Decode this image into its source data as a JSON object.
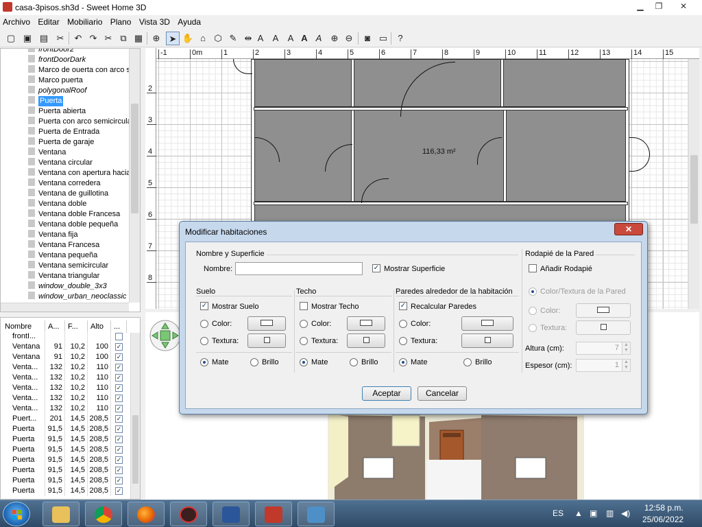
{
  "window": {
    "title": "casa-3pisos.sh3d - Sweet Home 3D"
  },
  "menu": [
    "Archivo",
    "Editar",
    "Mobiliario",
    "Plano",
    "Vista 3D",
    "Ayuda"
  ],
  "catalog": {
    "items": [
      {
        "label": "frontDoor2",
        "italic": true
      },
      {
        "label": "frontDoorDark",
        "italic": true
      },
      {
        "label": "Marco de ouerta con arco s",
        "italic": false
      },
      {
        "label": "Marco puerta",
        "italic": false
      },
      {
        "label": "polygonalRoof",
        "italic": true
      },
      {
        "label": "Puerta",
        "italic": false,
        "selected": true
      },
      {
        "label": "Puerta abierta",
        "italic": false
      },
      {
        "label": "Puerta con arco semicircula",
        "italic": false
      },
      {
        "label": "Puerta de Entrada",
        "italic": false
      },
      {
        "label": "Puerta de garaje",
        "italic": false
      },
      {
        "label": "Ventana",
        "italic": false
      },
      {
        "label": "Ventana circular",
        "italic": false
      },
      {
        "label": "Ventana con apertura hacia",
        "italic": false
      },
      {
        "label": "Ventana corredera",
        "italic": false
      },
      {
        "label": "Ventana de guillotina",
        "italic": false
      },
      {
        "label": "Ventana doble",
        "italic": false
      },
      {
        "label": "Ventana doble Francesa",
        "italic": false
      },
      {
        "label": "Ventana doble pequeña",
        "italic": false
      },
      {
        "label": "Ventana fija",
        "italic": false
      },
      {
        "label": "Ventana Francesa",
        "italic": false
      },
      {
        "label": "Ventana pequeña",
        "italic": false
      },
      {
        "label": "Ventana semicircular",
        "italic": false
      },
      {
        "label": "Ventana triangular",
        "italic": false
      },
      {
        "label": "window_double_3x3",
        "italic": true
      },
      {
        "label": "window_urban_neoclassic",
        "italic": true
      }
    ]
  },
  "furniture": {
    "headers": [
      "Nombre",
      "A...",
      "F...",
      "Alto",
      "..."
    ],
    "rows": [
      [
        "frontI...",
        "",
        "",
        "",
        ""
      ],
      [
        "Ventana",
        "91",
        "10,2",
        "100",
        "✓"
      ],
      [
        "Ventana",
        "91",
        "10,2",
        "100",
        "✓"
      ],
      [
        "Venta...",
        "132",
        "10,2",
        "110",
        "✓"
      ],
      [
        "Venta...",
        "132",
        "10,2",
        "110",
        "✓"
      ],
      [
        "Venta...",
        "132",
        "10,2",
        "110",
        "✓"
      ],
      [
        "Venta...",
        "132",
        "10,2",
        "110",
        "✓"
      ],
      [
        "Venta...",
        "132",
        "10,2",
        "110",
        "✓"
      ],
      [
        "Puert...",
        "201",
        "14,5",
        "208,5",
        "✓"
      ],
      [
        "Puerta",
        "91,5",
        "14,5",
        "208,5",
        "✓"
      ],
      [
        "Puerta",
        "91,5",
        "14,5",
        "208,5",
        "✓"
      ],
      [
        "Puerta",
        "91,5",
        "14,5",
        "208,5",
        "✓"
      ],
      [
        "Puerta",
        "91,5",
        "14,5",
        "208,5",
        "✓"
      ],
      [
        "Puerta",
        "91,5",
        "14,5",
        "208,5",
        "✓"
      ],
      [
        "Puerta",
        "91,5",
        "14,5",
        "208,5",
        "✓"
      ],
      [
        "Puerta",
        "91,5",
        "14,5",
        "208,5",
        "✓"
      ]
    ]
  },
  "plan": {
    "ruler_x": [
      "-1",
      "0m",
      "1",
      "2",
      "3",
      "4",
      "5",
      "6",
      "7",
      "8",
      "9",
      "10",
      "11",
      "12",
      "13",
      "14",
      "15"
    ],
    "ruler_y": [
      "2",
      "3",
      "4",
      "5",
      "6",
      "7",
      "8"
    ],
    "area_label": "116,33 m²"
  },
  "dialog": {
    "title": "Modificar habitaciones",
    "close": "✕",
    "name_section": {
      "title": "Nombre y Superficie",
      "name_label": "Nombre:",
      "name_value": "",
      "show_area_label": "Mostrar Superficie",
      "show_area_checked": true
    },
    "floor": {
      "title": "Suelo",
      "show_label": "Mostrar Suelo",
      "show_checked": true,
      "color_label": "Color:",
      "texture_label": "Textura:",
      "matte_label": "Mate",
      "gloss_label": "Brillo"
    },
    "ceiling": {
      "title": "Techo",
      "show_label": "Mostrar Techo",
      "show_checked": false,
      "color_label": "Color:",
      "texture_label": "Textura:",
      "matte_label": "Mate",
      "gloss_label": "Brillo"
    },
    "walls": {
      "title": "Paredes alrededor de la habitación",
      "recalc_label": "Recalcular Paredes",
      "recalc_checked": true,
      "color_label": "Color:",
      "texture_label": "Textura:",
      "matte_label": "Mate",
      "gloss_label": "Brillo"
    },
    "baseboard": {
      "title": "Rodapié de la Pared",
      "add_label": "Añadir Rodapié",
      "add_checked": false,
      "same_label": "Color/Textura de la Pared",
      "color_label": "Color:",
      "texture_label": "Textura:",
      "height_label": "Altura (cm):",
      "height_value": "7",
      "thickness_label": "Espesor (cm):",
      "thickness_value": "1"
    },
    "ok": "Aceptar",
    "cancel": "Cancelar"
  },
  "taskbar": {
    "lang": "ES",
    "time": "12:58 p.m.",
    "date": "25/06/2022"
  },
  "colors": {
    "selection": "#3399ff",
    "room_fill": "#8f8f8f",
    "dialog_frame": "#c6d8ec"
  }
}
